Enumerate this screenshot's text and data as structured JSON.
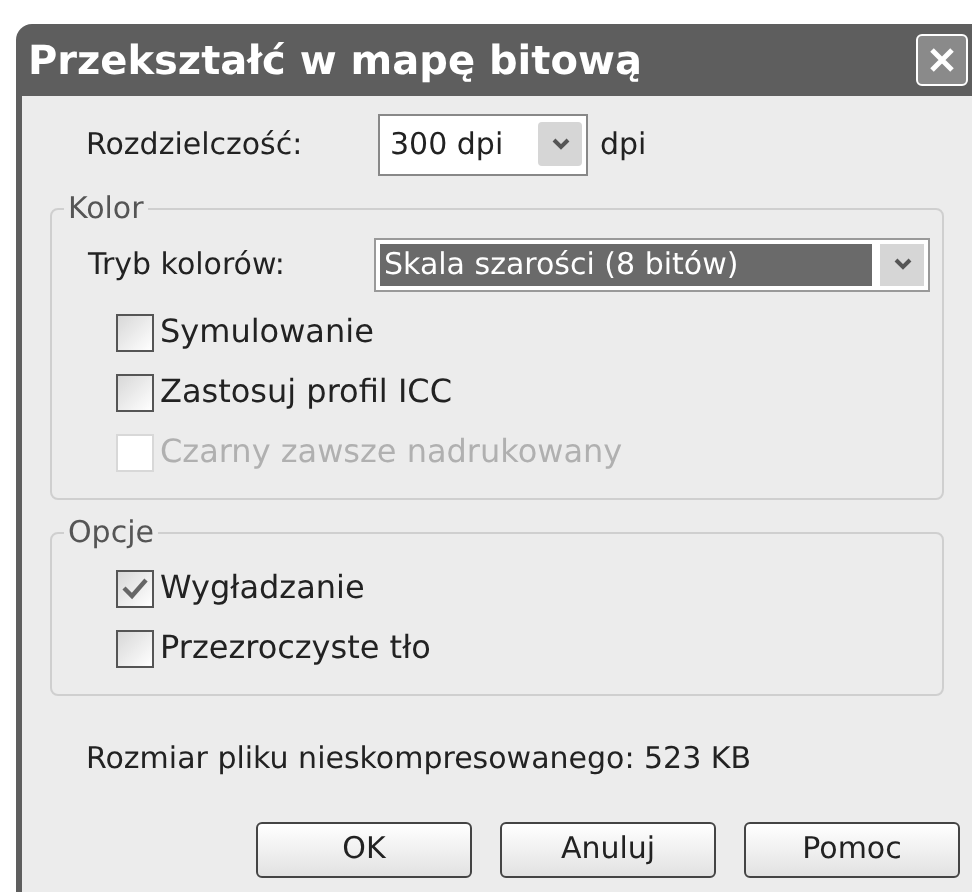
{
  "window": {
    "title": "Przekształć w mapę bitową"
  },
  "resolution": {
    "label": "Rozdzielczość:",
    "value": "300 dpi",
    "unit": "dpi"
  },
  "color_group": {
    "title": "Kolor",
    "mode_label": "Tryb kolorów:",
    "mode_value": "Skala szarości (8 bitów)",
    "options": [
      {
        "label": "Symulowanie",
        "checked": false,
        "disabled": false
      },
      {
        "label": "Zastosuj profil ICC",
        "checked": false,
        "disabled": false
      },
      {
        "label": "Czarny zawsze nadrukowany",
        "checked": false,
        "disabled": true
      }
    ]
  },
  "options_group": {
    "title": "Opcje",
    "options": [
      {
        "label": "Wygładzanie",
        "checked": true,
        "disabled": false
      },
      {
        "label": "Przezroczyste tło",
        "checked": false,
        "disabled": false
      }
    ]
  },
  "file_size": "Rozmiar pliku nieskompresowanego: 523 KB",
  "buttons": [
    "OK",
    "Anuluj",
    "Pomoc"
  ]
}
